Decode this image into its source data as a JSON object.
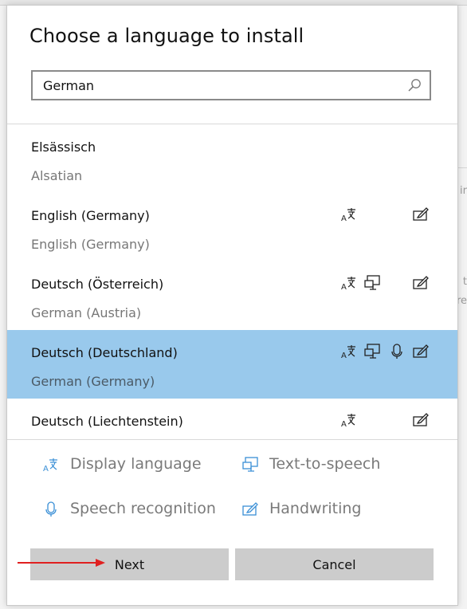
{
  "dialog": {
    "title": "Choose a language to install"
  },
  "search": {
    "value": "German"
  },
  "languages": [
    {
      "native": "Elsässisch",
      "english": "Alsatian",
      "features": [],
      "selected": false
    },
    {
      "native": "English (Germany)",
      "english": "English (Germany)",
      "features": [
        "display-language",
        "handwriting"
      ],
      "selected": false
    },
    {
      "native": "Deutsch (Österreich)",
      "english": "German (Austria)",
      "features": [
        "display-language",
        "text-to-speech",
        "handwriting"
      ],
      "selected": false
    },
    {
      "native": "Deutsch (Deutschland)",
      "english": "German (Germany)",
      "features": [
        "display-language",
        "text-to-speech",
        "speech-recognition",
        "handwriting"
      ],
      "selected": true
    },
    {
      "native": "Deutsch (Liechtenstein)",
      "english": "",
      "features": [
        "display-language",
        "handwriting"
      ],
      "selected": false
    }
  ],
  "legend": {
    "display_language": "Display language",
    "text_to_speech": "Text-to-speech",
    "speech_recognition": "Speech recognition",
    "handwriting": "Handwriting"
  },
  "buttons": {
    "next": "Next",
    "cancel": "Cancel"
  },
  "background_fragments": [
    "ir",
    "t",
    "re"
  ],
  "colors": {
    "selected_row": "#99c9ec",
    "icon_blue": "#3a8fd6",
    "button_gray": "#cccccc",
    "arrow_red": "#e02020"
  }
}
